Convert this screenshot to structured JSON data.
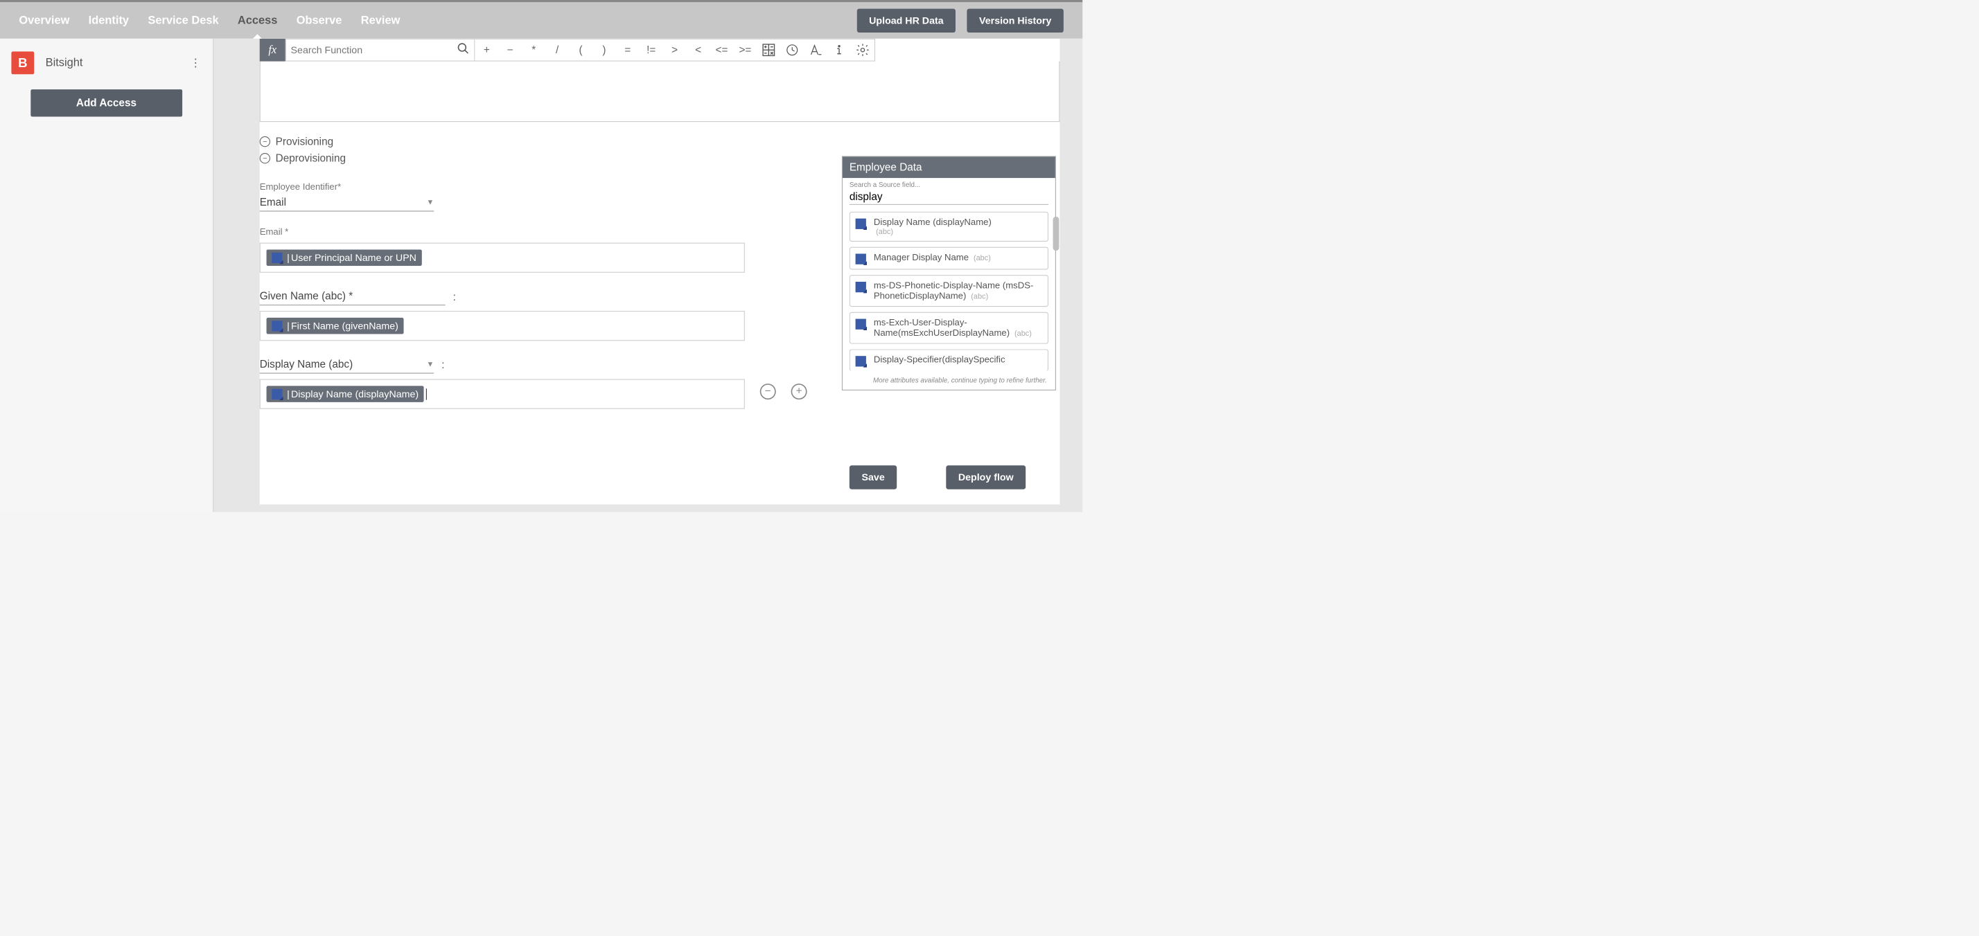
{
  "nav": {
    "tabs": [
      "Overview",
      "Identity",
      "Service Desk",
      "Access",
      "Observe",
      "Review"
    ],
    "active": "Access",
    "upload": "Upload HR Data",
    "history": "Version History"
  },
  "sidebar": {
    "app_name": "Bitsight",
    "app_initial": "B",
    "add_access": "Add Access"
  },
  "fx": {
    "label": "fx",
    "search_placeholder": "Search Function",
    "ops_text": [
      "+",
      "−",
      "*",
      "/",
      "(",
      ")",
      "=",
      "!=",
      ">",
      "<",
      "<=",
      ">="
    ]
  },
  "sections": {
    "provisioning": "Provisioning",
    "deprovisioning": "Deprovisioning"
  },
  "fields": {
    "emp_id_label": "Employee Identifier*",
    "emp_id_value": "Email",
    "email_label": "Email *",
    "email_chip": "User Principal Name or UPN",
    "given_label": "Given Name (abc) *",
    "given_chip": "First Name (givenName)",
    "display_label": "Display Name (abc)",
    "display_chip": "Display Name (displayName)"
  },
  "emp_panel": {
    "title": "Employee Data",
    "search_label": "Search a Source field...",
    "search_value": "display",
    "items": [
      {
        "name": "Display Name (displayName)",
        "type": "(abc)",
        "type_inline": false
      },
      {
        "name": "Manager Display Name",
        "type": "(abc)",
        "type_inline": true
      },
      {
        "name": "ms-DS-Phonetic-Display-Name (msDS-PhoneticDisplayName)",
        "type": "(abc)",
        "type_inline": true
      },
      {
        "name": "ms-Exch-User-Display-Name(msExchUserDisplayName)",
        "type": "(abc)",
        "type_inline": true
      },
      {
        "name": "Display-Specifier(displaySpecific",
        "type": "",
        "type_inline": true
      }
    ],
    "more": "More attributes available, continue typing to refine further."
  },
  "actions": {
    "save": "Save",
    "deploy": "Deploy flow"
  }
}
